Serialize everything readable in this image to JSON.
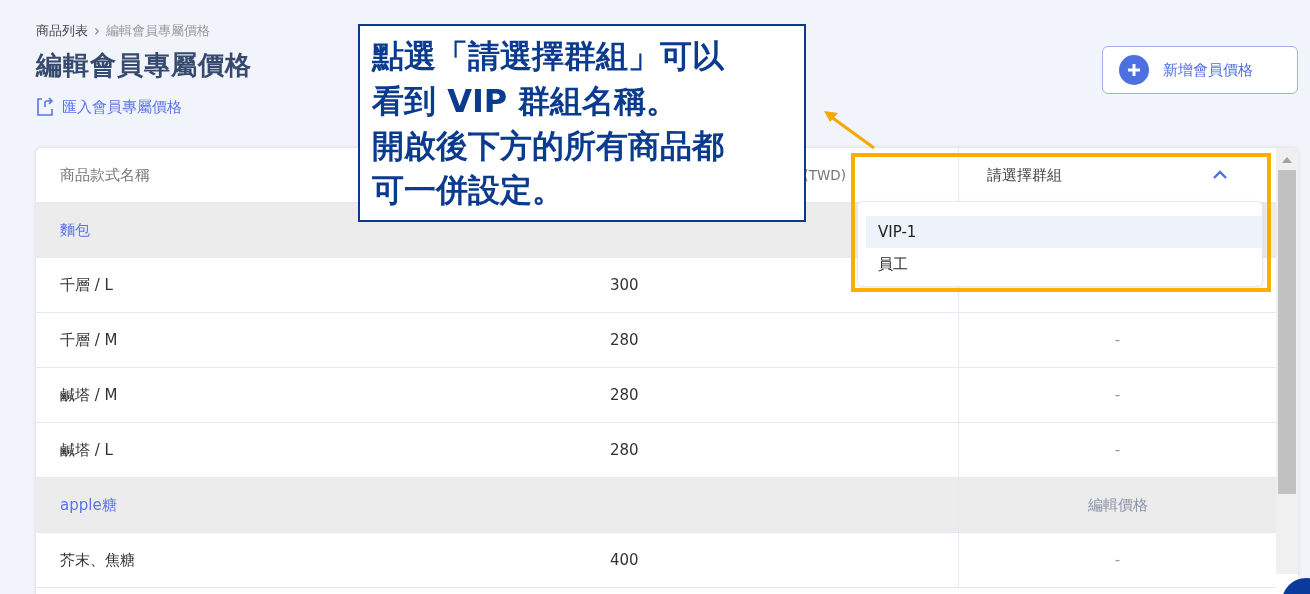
{
  "breadcrumb": [
    {
      "label": "商品列表",
      "current": false
    },
    {
      "label": "編輯會員專屬價格",
      "current": true
    }
  ],
  "breadcrumb_separator": "›",
  "title": "編輯會員專屬價格",
  "import_link": "匯入會員專屬價格",
  "add_button": "新增會員價格",
  "table": {
    "columns": [
      "商品款式名稱",
      "(TWD)"
    ],
    "group_select": {
      "label": "請選擇群組",
      "expanded": true,
      "options": [
        {
          "label": "VIP-1",
          "highlighted": true
        },
        {
          "label": "員工",
          "highlighted": false
        }
      ]
    },
    "rows": [
      {
        "kind": "group",
        "name": "麵包"
      },
      {
        "kind": "item",
        "name": "千層 / L",
        "price": "300"
      },
      {
        "kind": "item",
        "name": "千層 / M",
        "price": "280",
        "member": "-"
      },
      {
        "kind": "item",
        "name": "鹹塔 / M",
        "price": "280",
        "member": "-"
      },
      {
        "kind": "item",
        "name": "鹹塔 / L",
        "price": "280",
        "member": "-"
      },
      {
        "kind": "group",
        "name": "apple糖",
        "action": "編輯價格"
      },
      {
        "kind": "item",
        "name": "芥末、焦糖",
        "price": "400",
        "member": "-"
      }
    ]
  },
  "callout": [
    "點選「請選擇群組」可以",
    "看到 VIP 群組名稱。",
    "開啟後下方的所有商品都",
    "可一併設定。"
  ]
}
